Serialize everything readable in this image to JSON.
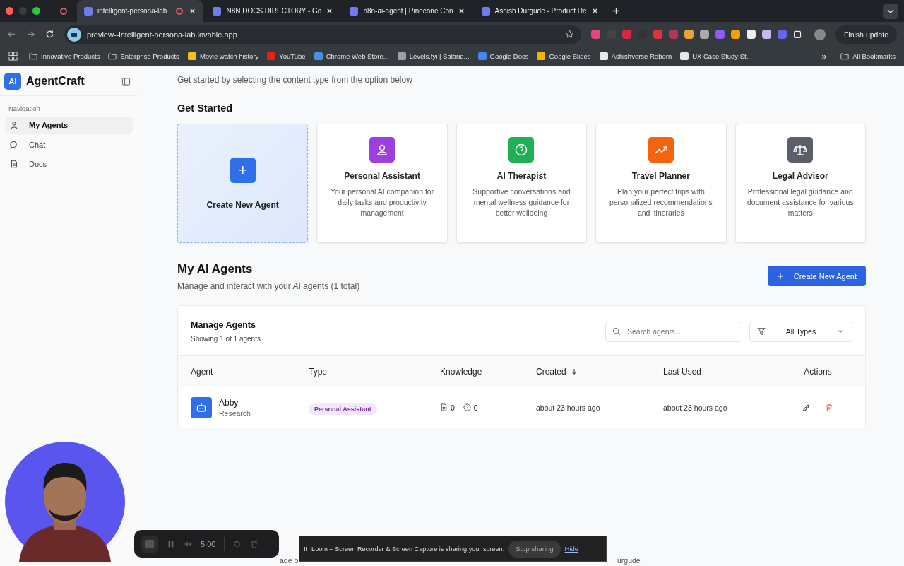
{
  "browser": {
    "tabs": [
      {
        "title": "intelligent-persona-lab",
        "selected": true,
        "recording": true
      },
      {
        "title": "N8N DOCS DIRECTORY - Go",
        "selected": false,
        "recording": false
      },
      {
        "title": "n8n-ai-agent | Pinecone Con",
        "selected": false,
        "recording": false
      },
      {
        "title": "Ashish Durgude - Product De",
        "selected": false,
        "recording": false
      }
    ],
    "url": "preview--intelligent-persona-lab.lovable.app",
    "update_button": "Finish update",
    "bookmarks": [
      {
        "label": "Innovative Products",
        "kind": "folder"
      },
      {
        "label": "Enterprise Products",
        "kind": "folder"
      },
      {
        "label": "Movie watch history",
        "kind": "site",
        "color": "#f2c21b"
      },
      {
        "label": "YouTube",
        "kind": "site",
        "color": "#e62117"
      },
      {
        "label": "Chrome Web Store...",
        "kind": "site",
        "color": "#4a90e2"
      },
      {
        "label": "Levels.fyi | Salarie...",
        "kind": "site",
        "color": "#9aa0a6"
      },
      {
        "label": "Google Docs",
        "kind": "site",
        "color": "#4285f4"
      },
      {
        "label": "Google Slides",
        "kind": "site",
        "color": "#f4b400"
      },
      {
        "label": "Ashishverse Reborn",
        "kind": "site",
        "color": "#e8e8e8"
      },
      {
        "label": "UX Case Study St...",
        "kind": "site",
        "color": "#e8e8e8"
      }
    ],
    "more": "»",
    "all_bookmarks": "All Bookmarks"
  },
  "sidebar": {
    "logo": "AI",
    "brand": "AgentCraft",
    "section": "Navigation",
    "items": [
      {
        "label": "My Agents",
        "kind": "user",
        "selected": true
      },
      {
        "label": "Chat",
        "kind": "chat",
        "selected": false
      },
      {
        "label": "Docs",
        "kind": "doc",
        "selected": false
      }
    ]
  },
  "main": {
    "subtitle": "Get started by selecting the content type from the option below",
    "get_started": "Get Started",
    "create_card": {
      "icon": "+",
      "label": "Create New Agent"
    },
    "templates": [
      {
        "title": "Personal Assistant",
        "description": "Your personal AI companion for daily tasks and productivity management",
        "kind": "person",
        "color": "#9b3fe0"
      },
      {
        "title": "AI Therapist",
        "description": "Supportive conversations and mental wellness guidance for better wellbeing",
        "kind": "question",
        "color": "#1fb055"
      },
      {
        "title": "Travel Planner",
        "description": "Plan your perfect trips with personalized recommendations and itineraries",
        "kind": "trend",
        "color": "#f2650e"
      },
      {
        "title": "Legal Advisor",
        "description": "Professional legal guidance and document assistance for various matters",
        "kind": "scale",
        "color": "#5b5f6a"
      }
    ],
    "agents_title": "My AI Agents",
    "agents_subtitle": "Manage and interact with your AI agents (1 total)",
    "create_button": "Create New Agent",
    "panel": {
      "title": "Manage Agents",
      "count": "Showing 1 of 1 agents",
      "search": {
        "placeholder": "Search agents..."
      },
      "filter": "All Types",
      "table": {
        "columns": [
          {
            "label": "Agent",
            "sorted": false
          },
          {
            "label": "Type",
            "sorted": false
          },
          {
            "label": "Knowledge",
            "sorted": false
          },
          {
            "label": "Created",
            "sorted": true
          },
          {
            "label": "Last Used",
            "sorted": false
          },
          {
            "label": "Actions",
            "sorted": false
          }
        ],
        "rows": [
          {
            "name": "Abby",
            "role": "Research",
            "type": "Personal Assistant",
            "docs": "0",
            "questions": "0",
            "created": "about 23 hours ago",
            "last_used": "about 23 hours ago"
          }
        ]
      }
    }
  },
  "footer_fragments": [
    "ade b",
    "urgude"
  ],
  "recorder": {
    "time": "5:00"
  },
  "share_bar": {
    "pause": "II",
    "message": "Loom – Screen Recorder & Screen Capture is sharing your screen.",
    "stop": "Stop sharing",
    "hide": "Hide"
  }
}
